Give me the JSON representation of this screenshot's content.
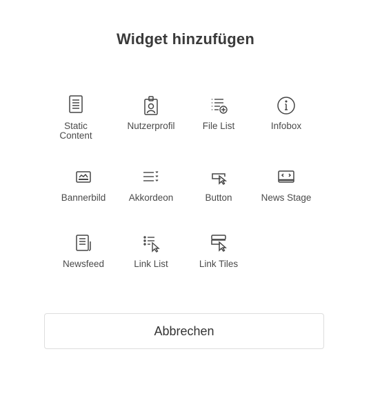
{
  "dialog": {
    "title": "Widget hinzufügen",
    "cancel_label": "Abbrechen"
  },
  "widgets": [
    {
      "label": "Static\nContent",
      "icon": "document-lines-icon"
    },
    {
      "label": "Nutzerprofil",
      "icon": "id-badge-icon"
    },
    {
      "label": "File List",
      "icon": "file-list-add-icon"
    },
    {
      "label": "Infobox",
      "icon": "info-circle-icon"
    },
    {
      "label": "Bannerbild",
      "icon": "banner-image-icon"
    },
    {
      "label": "Akkordeon",
      "icon": "accordion-icon"
    },
    {
      "label": "Button",
      "icon": "button-cursor-icon"
    },
    {
      "label": "News Stage",
      "icon": "news-stage-icon"
    },
    {
      "label": "Newsfeed",
      "icon": "newsfeed-icon"
    },
    {
      "label": "Link List",
      "icon": "link-list-icon"
    },
    {
      "label": "Link Tiles",
      "icon": "link-tiles-icon"
    }
  ],
  "colors": {
    "icon_stroke": "#444444",
    "text": "#4a4a4a",
    "border": "#dddddd"
  }
}
